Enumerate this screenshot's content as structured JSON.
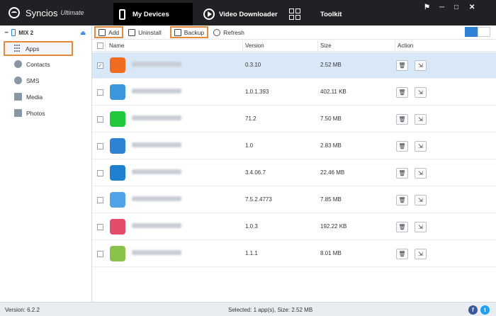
{
  "app": {
    "name": "Syncios",
    "edition": "Ultimate"
  },
  "tabs": [
    {
      "label": "My Devices"
    },
    {
      "label": "Video Downloader"
    },
    {
      "label": "Toolkit"
    }
  ],
  "window_controls": [
    "⚑",
    "─",
    "□",
    "✕"
  ],
  "device": {
    "name": "MIX 2"
  },
  "sidebar": {
    "items": [
      {
        "label": "Apps"
      },
      {
        "label": "Contacts"
      },
      {
        "label": "SMS"
      },
      {
        "label": "Media"
      },
      {
        "label": "Photos"
      }
    ]
  },
  "toolbar": {
    "add": "Add",
    "uninstall": "Uninstall",
    "backup": "Backup",
    "refresh": "Refresh"
  },
  "table": {
    "headers": {
      "name": "Name",
      "version": "Version",
      "size": "Size",
      "action": "Action"
    },
    "rows": [
      {
        "version": "0.3.10",
        "size": "2.52 MB",
        "selected": true,
        "icon_color": "#f06a20"
      },
      {
        "version": "1.0.1.393",
        "size": "402.11 KB",
        "selected": false,
        "icon_color": "#3a96dd"
      },
      {
        "version": "71.2",
        "size": "7.50 MB",
        "selected": false,
        "icon_color": "#20c83a"
      },
      {
        "version": "1.0",
        "size": "2.83 MB",
        "selected": false,
        "icon_color": "#2e82d6"
      },
      {
        "version": "3.4.06.7",
        "size": "22.46 MB",
        "selected": false,
        "icon_color": "#1f7fd0"
      },
      {
        "version": "7.5.2.4773",
        "size": "7.85 MB",
        "selected": false,
        "icon_color": "#4fa3e6"
      },
      {
        "version": "1.0.3",
        "size": "192.22 KB",
        "selected": false,
        "icon_color": "#e44c6a"
      },
      {
        "version": "1.1.1",
        "size": "8.01 MB",
        "selected": false,
        "icon_color": "#8bc34a"
      }
    ]
  },
  "status": {
    "version": "Version: 6.2.2",
    "selection": "Selected: 1 app(s), Size: 2.52 MB"
  },
  "colors": {
    "accent": "#2e82d6",
    "highlight": "#e58a3a",
    "titlebar": "#1f2124"
  }
}
